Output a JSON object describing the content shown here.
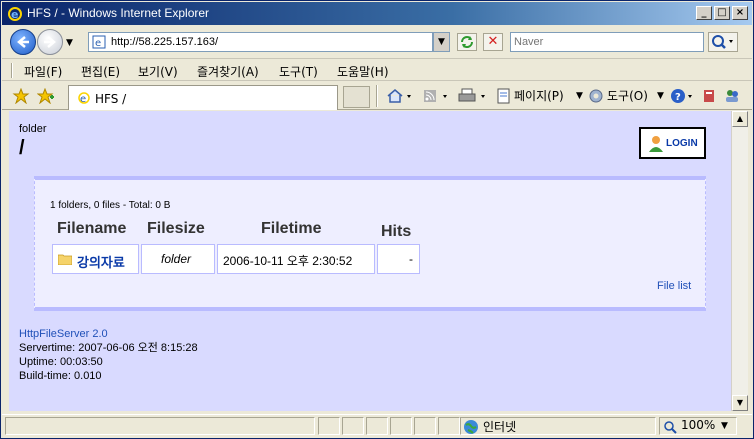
{
  "window": {
    "title": "HFS / - Windows Internet Explorer"
  },
  "address": {
    "url": "http://58.225.157.163/",
    "search_placeholder": "Naver"
  },
  "menu": [
    "파일(F)",
    "편집(E)",
    "보기(V)",
    "즐겨찾기(A)",
    "도구(T)",
    "도움말(H)"
  ],
  "tab": {
    "label": "HFS /"
  },
  "toolbar": {
    "page_label": "페이지(P)",
    "tools_label": "도구(O)"
  },
  "page": {
    "folder_label": "folder",
    "path": "/",
    "login_label": "LOGIN",
    "summary": "1 folders, 0 files - Total: 0 B",
    "columns": [
      "Filename",
      "Filesize",
      "Filetime",
      "Hits"
    ],
    "rows": [
      {
        "name": "강의자료",
        "size": "folder",
        "time": "2006-10-11 오후 2:30:52",
        "hits": "-"
      }
    ],
    "file_list_link": "File list",
    "footer": {
      "server": "HttpFileServer 2.0",
      "servertime": "Servertime: 2007-06-06 오전 8:15:28",
      "uptime": "Uptime: 00:03:50",
      "buildtime": "Build-time: 0.010"
    }
  },
  "status": {
    "zone": "인터넷",
    "zoom": "100%"
  }
}
